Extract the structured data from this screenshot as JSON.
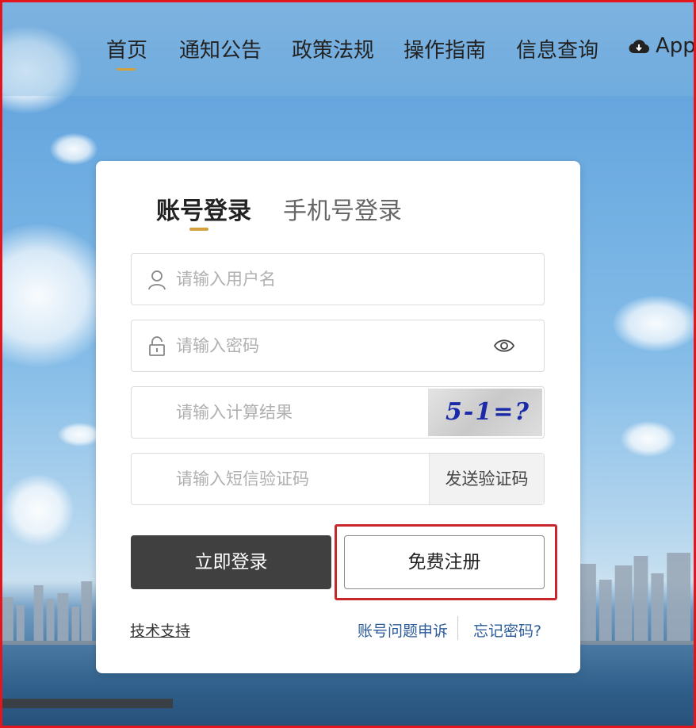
{
  "nav": {
    "items": [
      "首页",
      "通知公告",
      "政策法规",
      "操作指南",
      "信息查询"
    ],
    "app_label": "App"
  },
  "login": {
    "tabs": {
      "account": "账号登录",
      "phone": "手机号登录"
    },
    "username_placeholder": "请输入用户名",
    "password_placeholder": "请输入密码",
    "captcha_placeholder": "请输入计算结果",
    "captcha_image_text": "5-1=?",
    "sms_placeholder": "请输入短信验证码",
    "send_code_label": "发送验证码",
    "login_button": "立即登录",
    "register_button": "免费注册",
    "tech_support": "技术支持",
    "account_appeal": "账号问题申诉",
    "forgot_password": "忘记密码?"
  },
  "colors": {
    "accent": "#d3a23c",
    "primary_button": "#404040",
    "highlight": "#c8272b",
    "link": "#2d5c9a"
  }
}
